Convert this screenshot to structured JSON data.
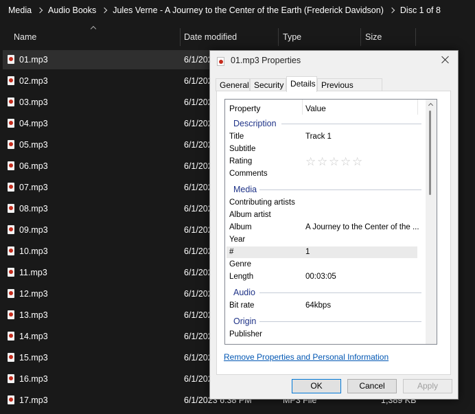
{
  "breadcrumb": [
    "Media",
    "Audio Books",
    "Jules Verne - A Journey to the Center of the Earth (Frederick Davidson)",
    "Disc 1 of 8"
  ],
  "columns": {
    "name": "Name",
    "date": "Date modified",
    "type": "Type",
    "size": "Size"
  },
  "files": [
    {
      "name": "01.mp3",
      "date": "6/1/202"
    },
    {
      "name": "02.mp3",
      "date": "6/1/202"
    },
    {
      "name": "03.mp3",
      "date": "6/1/202"
    },
    {
      "name": "04.mp3",
      "date": "6/1/202"
    },
    {
      "name": "05.mp3",
      "date": "6/1/202"
    },
    {
      "name": "06.mp3",
      "date": "6/1/202"
    },
    {
      "name": "07.mp3",
      "date": "6/1/202"
    },
    {
      "name": "08.mp3",
      "date": "6/1/202"
    },
    {
      "name": "09.mp3",
      "date": "6/1/202"
    },
    {
      "name": "10.mp3",
      "date": "6/1/202"
    },
    {
      "name": "11.mp3",
      "date": "6/1/202"
    },
    {
      "name": "12.mp3",
      "date": "6/1/202"
    },
    {
      "name": "13.mp3",
      "date": "6/1/202"
    },
    {
      "name": "14.mp3",
      "date": "6/1/202"
    },
    {
      "name": "15.mp3",
      "date": "6/1/202"
    },
    {
      "name": "16.mp3",
      "date": "6/1/202"
    }
  ],
  "last_file": {
    "name": "17.mp3",
    "date": "6/1/2023 6:38 PM",
    "type": "MP3 File",
    "size": "1,389 KB"
  },
  "dialog": {
    "title": "01.mp3 Properties",
    "tabs": [
      "General",
      "Security",
      "Details",
      "Previous Versions"
    ],
    "active_tab": "Details",
    "list_header": {
      "property": "Property",
      "value": "Value"
    },
    "groups": {
      "description": "Description",
      "media": "Media",
      "audio": "Audio",
      "origin": "Origin"
    },
    "props": {
      "title": {
        "label": "Title",
        "value": "Track  1"
      },
      "subtitle": {
        "label": "Subtitle",
        "value": ""
      },
      "rating": {
        "label": "Rating",
        "stars": 0,
        "max_stars": 5
      },
      "comments": {
        "label": "Comments",
        "value": ""
      },
      "contributing_artists": {
        "label": "Contributing artists",
        "value": ""
      },
      "album_artist": {
        "label": "Album artist",
        "value": ""
      },
      "album": {
        "label": "Album",
        "value": "A Journey to the Center of the ..."
      },
      "year": {
        "label": "Year",
        "value": ""
      },
      "track": {
        "label": "#",
        "value": "1"
      },
      "genre": {
        "label": "Genre",
        "value": ""
      },
      "length": {
        "label": "Length",
        "value": "00:03:05"
      },
      "bit_rate": {
        "label": "Bit rate",
        "value": "64kbps"
      },
      "publisher": {
        "label": "Publisher",
        "value": ""
      }
    },
    "remove_link": "Remove Properties and Personal Information",
    "buttons": {
      "ok": "OK",
      "cancel": "Cancel",
      "apply": "Apply"
    }
  }
}
